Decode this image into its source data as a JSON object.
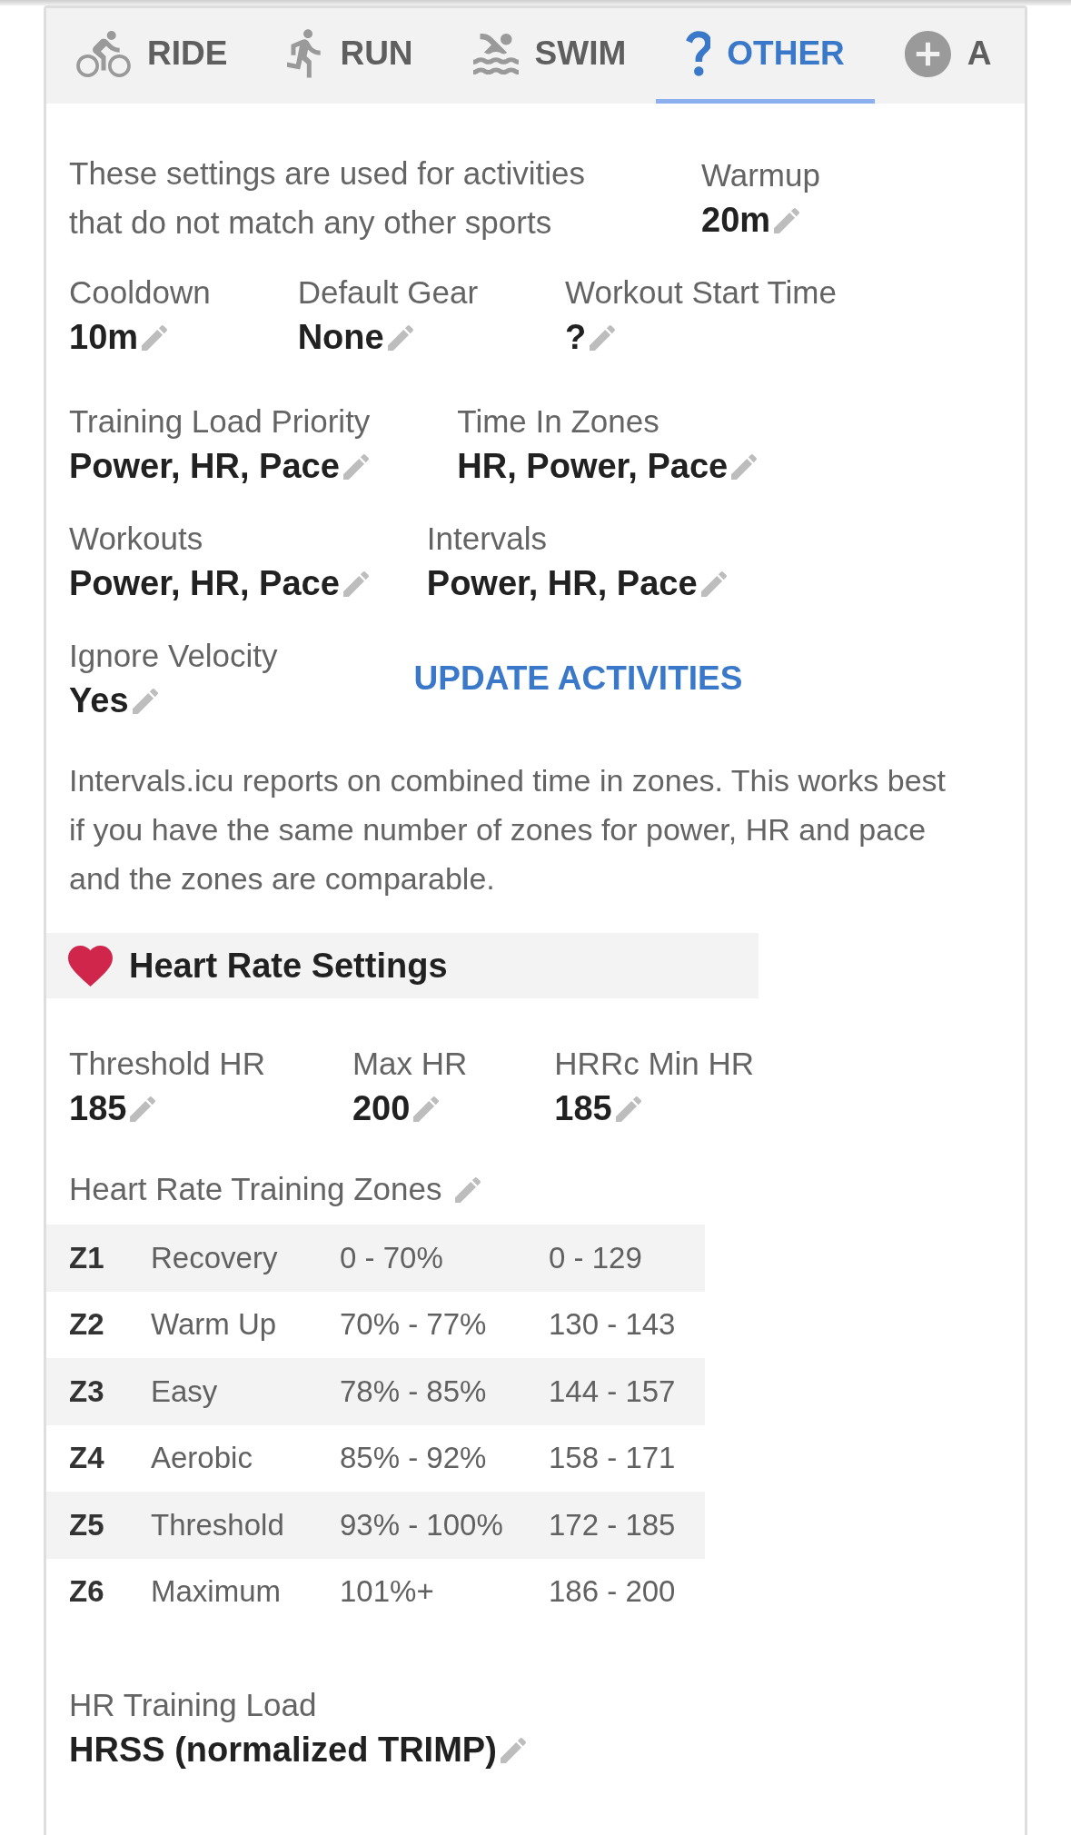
{
  "tabs": [
    {
      "label": "RIDE",
      "selected": false
    },
    {
      "label": "RUN",
      "selected": false
    },
    {
      "label": "SWIM",
      "selected": false
    },
    {
      "label": "OTHER",
      "selected": true
    },
    {
      "label": "A",
      "selected": false
    }
  ],
  "intro": {
    "text": "These settings are used for activities that do not match any other sports",
    "field": {
      "label": "Warmup",
      "value": "20m"
    }
  },
  "field_rows": [
    [
      {
        "kind": "field",
        "label": "Cooldown",
        "value": "10m"
      },
      {
        "kind": "field",
        "label": "Default Gear",
        "value": "None"
      },
      {
        "kind": "field",
        "label": "Workout Start Time",
        "value": "?"
      }
    ],
    [
      {
        "kind": "field",
        "label": "Training Load Priority",
        "value": "Power, HR, Pace"
      },
      {
        "kind": "field",
        "label": "Time In Zones",
        "value": "HR, Power, Pace"
      }
    ],
    [
      {
        "kind": "field",
        "label": "Workouts",
        "value": "Power, HR, Pace"
      },
      {
        "kind": "field",
        "label": "Intervals",
        "value": "Power, HR, Pace"
      }
    ],
    [
      {
        "kind": "field",
        "label": "Ignore Velocity",
        "value": "Yes"
      },
      {
        "kind": "button",
        "label": "UPDATE ACTIVITIES"
      }
    ]
  ],
  "note": "Intervals.icu reports on combined time in zones. This works best if you have the same number of zones for power, HR and pace and the zones are comparable.",
  "heart_rate": {
    "title": "Heart Rate Settings",
    "fields": [
      {
        "label": "Threshold HR",
        "value": "185"
      },
      {
        "label": "Max HR",
        "value": "200"
      },
      {
        "label": "HRRc Min HR",
        "value": "185"
      }
    ],
    "zones_title": "Heart Rate Training Zones",
    "zones": [
      {
        "zone": "Z1",
        "name": "Recovery",
        "percent": "0 - 70%",
        "bpm": "0 - 129"
      },
      {
        "zone": "Z2",
        "name": "Warm Up",
        "percent": "70% - 77%",
        "bpm": "130 - 143"
      },
      {
        "zone": "Z3",
        "name": "Easy",
        "percent": "78% - 85%",
        "bpm": "144 - 157"
      },
      {
        "zone": "Z4",
        "name": "Aerobic",
        "percent": "85% - 92%",
        "bpm": "158 - 171"
      },
      {
        "zone": "Z5",
        "name": "Threshold",
        "percent": "93% - 100%",
        "bpm": "172 - 185"
      },
      {
        "zone": "Z6",
        "name": "Maximum",
        "percent": "101%+",
        "bpm": "186 - 200"
      }
    ],
    "training_load": {
      "label": "HR Training Load",
      "value": "HRSS (normalized TRIMP)"
    }
  }
}
